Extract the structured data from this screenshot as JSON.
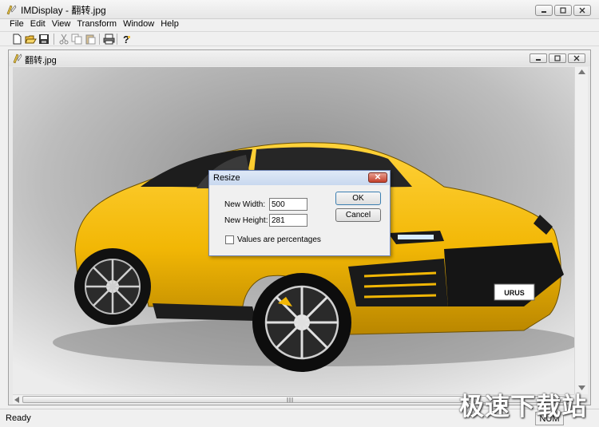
{
  "window": {
    "title": "IMDisplay - 翻转.jpg"
  },
  "menu": [
    "File",
    "Edit",
    "View",
    "Transform",
    "Window",
    "Help"
  ],
  "toolbar": {
    "icons": [
      "new-file-icon",
      "open-folder-icon",
      "save-icon",
      "cut-icon",
      "copy-icon",
      "paste-icon",
      "print-icon",
      "help-icon"
    ]
  },
  "document": {
    "title": "翻转.jpg"
  },
  "dialog": {
    "title": "Resize",
    "close_glyph": "✕",
    "width_label": "New Width:",
    "width_value": "500",
    "height_label": "New Height:",
    "height_value": "281",
    "percent_label": "Values are percentages",
    "percent_checked": false,
    "ok_label": "OK",
    "cancel_label": "Cancel"
  },
  "photo": {
    "plate_text": "URUS"
  },
  "status": {
    "text": "Ready",
    "num": "NUM"
  },
  "watermark": "极速下载站",
  "colors": {
    "car": "#f2b705",
    "dialog_border": "#6f86b8",
    "close_red": "#c4402c"
  }
}
